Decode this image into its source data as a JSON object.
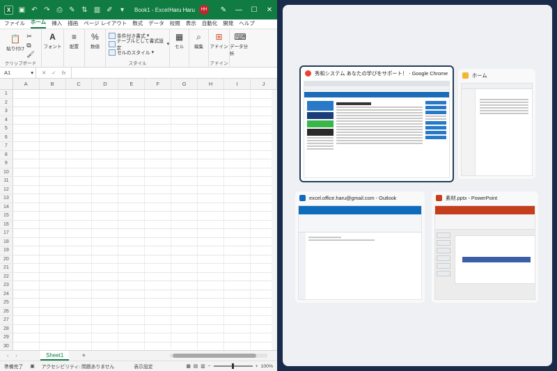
{
  "excel": {
    "title_icons": [
      "save-icon",
      "undo-icon",
      "redo-icon",
      "print-icon",
      "paint-icon",
      "sort-icon",
      "chart-icon",
      "pen-icon",
      "more-icon"
    ],
    "book_title": "Book1 - Excel",
    "user_name": "Haru Haru",
    "user_initials": "HH",
    "menu": [
      "ファイル",
      "ホーム",
      "挿入",
      "描画",
      "ページ レイアウト",
      "数式",
      "データ",
      "校閲",
      "表示",
      "自動化",
      "開発",
      "ヘルプ"
    ],
    "active_menu": "ホーム",
    "ribbon": {
      "paste": "貼り付け",
      "clipboard": "クリップボード",
      "font": "フォント",
      "alignment": "配置",
      "number": "数値",
      "conditional": "条件付き書式",
      "table_format": "テーブルとして書式設定",
      "cell_style": "セルのスタイル",
      "style": "スタイル",
      "cells": "セル",
      "edit": "編集",
      "addin": "アドイン",
      "addin_group": "アドイン",
      "analyze": "データ分析"
    },
    "name_box": "A1",
    "fx": "fx",
    "columns": [
      "A",
      "B",
      "C",
      "D",
      "E",
      "F",
      "G",
      "H",
      "I",
      "J"
    ],
    "rows": [
      "1",
      "2",
      "3",
      "4",
      "5",
      "6",
      "7",
      "8",
      "9",
      "10",
      "11",
      "12",
      "13",
      "14",
      "15",
      "16",
      "17",
      "18",
      "19",
      "20",
      "21",
      "22",
      "23",
      "24",
      "25",
      "26",
      "27",
      "28",
      "29",
      "30"
    ],
    "sheet_tab": "Sheet1",
    "add_sheet": "+",
    "status": {
      "ready": "準備完了",
      "accessibility": "アクセシビリティ: 問題ありません",
      "display_settings": "表示設定",
      "zoom": "100%"
    }
  },
  "snap": {
    "windows": [
      {
        "title": "秀和システム あなたの学びをサポート！ - Google Chrome",
        "icon_color": "#ea4335",
        "selected": true
      },
      {
        "title": "ホーム",
        "icon_color": "#f2b632",
        "selected": false
      },
      {
        "title": "excel.office.haru@gmail.com - Outlook",
        "icon_color": "#0f6cbd",
        "selected": false
      },
      {
        "title": "素材.pptx - PowerPoint",
        "icon_color": "#c43e1c",
        "selected": false
      }
    ]
  }
}
